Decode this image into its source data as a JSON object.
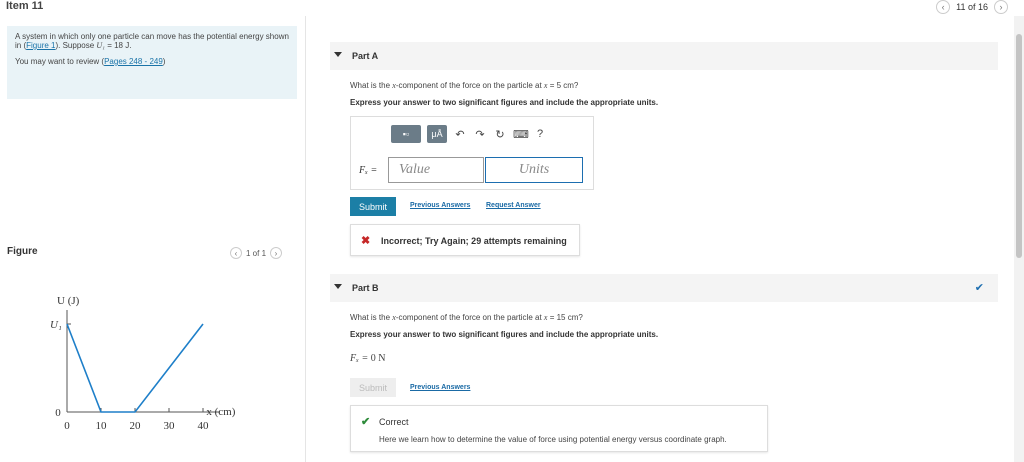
{
  "header": {
    "item_title": "Item 11",
    "pager_text": "11 of 16",
    "prev_icon": "chevron-left-icon",
    "next_icon": "chevron-right-icon"
  },
  "problem": {
    "text_before_link": "A system in which only one particle can move has the potential energy shown in (",
    "figure_link": "Figure 1",
    "text_after_link": "). Suppose ",
    "var": "U₁",
    "value": " = 18 J.",
    "review_prefix": "You may want to review (",
    "review_link": "Pages 248 - 249",
    "review_suffix": ")"
  },
  "figure": {
    "label": "Figure",
    "pager_text": "1 of 1"
  },
  "chart_data": {
    "type": "line",
    "x": [
      0,
      10,
      20,
      40
    ],
    "y_symbolic": [
      "U1",
      "0",
      "0",
      "U1"
    ],
    "xlabel": "x (cm)",
    "ylabel": "U (J)",
    "x_ticks": [
      "0",
      "10",
      "20",
      "30",
      "40"
    ],
    "y_ticks": [
      "0",
      "U1"
    ],
    "series_color": "#1e7fc9"
  },
  "partA": {
    "title": "Part A",
    "question_prefix": "What is the ",
    "question_var": "x",
    "question_mid": "-component of the force on the particle at ",
    "question_eq": "x",
    "question_value": " = 5 cm?",
    "instruction": "Express your answer to two significant figures and include the appropriate units.",
    "fx_label": "Fₓ =",
    "value_placeholder": "Value",
    "units_placeholder": "Units",
    "template_btn": "▪▫",
    "units_btn": "μÅ",
    "help": "?",
    "submit": "Submit",
    "previous_answers": "Previous Answers",
    "request_answer": "Request Answer",
    "feedback": "Incorrect; Try Again; 29 attempts remaining"
  },
  "partB": {
    "title": "Part B",
    "question_prefix": "What is the ",
    "question_var": "x",
    "question_mid": "-component of the force on the particle at ",
    "question_eq": "x",
    "question_value": " = 15 cm?",
    "instruction": "Express your answer to two significant figures and include the appropriate units.",
    "answer_label": "Fₓ = ",
    "answer_value": "0 N",
    "submit": "Submit",
    "previous_answers": "Previous Answers",
    "correct_title": "Correct",
    "correct_text": "Here we learn how to determine the value of force using potential energy versus coordinate graph."
  }
}
